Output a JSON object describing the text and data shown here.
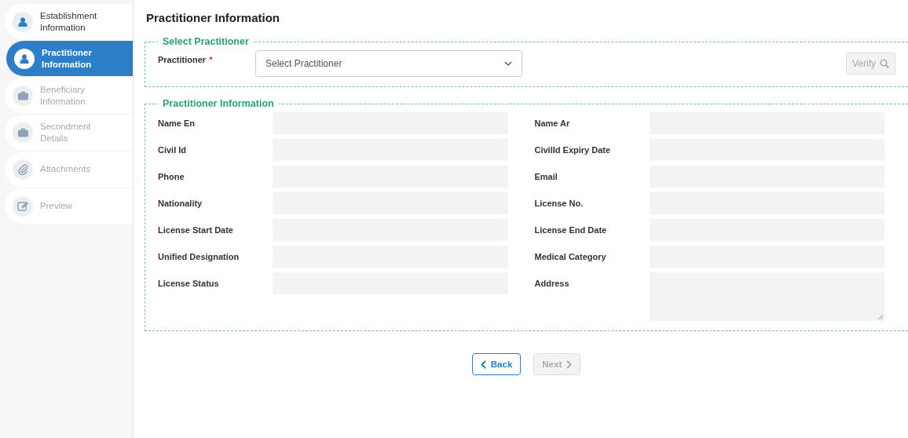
{
  "steps": [
    {
      "label": "Establishment Information",
      "kind": "person",
      "selected": false,
      "disabled": false
    },
    {
      "label": "Practitioner Information",
      "kind": "person",
      "selected": true,
      "disabled": false
    },
    {
      "label": "Beneficiary Information",
      "kind": "briefcase",
      "selected": false,
      "disabled": true
    },
    {
      "label": "Secondment Details",
      "kind": "briefcase",
      "selected": false,
      "disabled": true
    },
    {
      "label": "Attachments",
      "kind": "clip",
      "selected": false,
      "disabled": true
    },
    {
      "label": "Preview",
      "kind": "edit",
      "selected": false,
      "disabled": true
    }
  ],
  "page_title": "Practitioner Information",
  "select_section": {
    "legend": "Select Practitioner",
    "label": "Practitioner",
    "required_mark": "*",
    "placeholder": "Select Practitioner",
    "verify": {
      "label": "Verify",
      "disabled": true
    }
  },
  "info_section": {
    "legend": "Practitioner Information",
    "fields": [
      {
        "label": "Name En",
        "kind": "input"
      },
      {
        "label": "Name Ar",
        "kind": "input"
      },
      {
        "label": "Civil Id",
        "kind": "input"
      },
      {
        "label": "CivilId Expiry Date",
        "kind": "input"
      },
      {
        "label": "Phone",
        "kind": "input"
      },
      {
        "label": "Email",
        "kind": "input"
      },
      {
        "label": "Nationality",
        "kind": "input"
      },
      {
        "label": "License No.",
        "kind": "input"
      },
      {
        "label": "License Start Date",
        "kind": "input"
      },
      {
        "label": "License End Date",
        "kind": "input"
      },
      {
        "label": "Unified Designation",
        "kind": "input"
      },
      {
        "label": "Medical Category",
        "kind": "input"
      },
      {
        "label": "License Status",
        "kind": "input"
      },
      {
        "label": "Address",
        "kind": "textarea"
      }
    ]
  },
  "nav": {
    "back": {
      "label": "Back",
      "disabled": false
    },
    "next": {
      "label": "Next",
      "disabled": true
    }
  }
}
